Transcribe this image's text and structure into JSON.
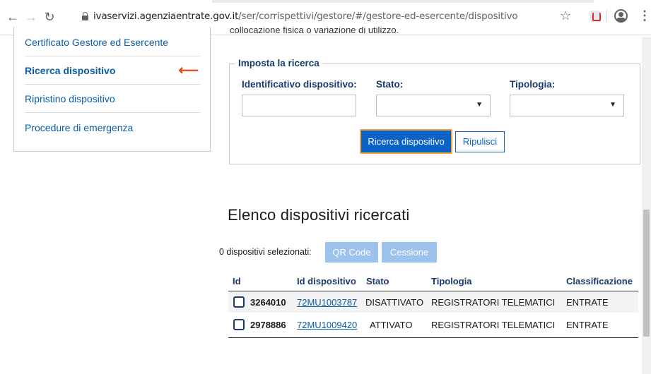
{
  "browser": {
    "url_domain": "ivaservizi.agenziaentrate.gov.it",
    "url_path": "/ser/corrispettivi/gestore/#/gestore-ed-esercente/dispositivo"
  },
  "sidebar": {
    "items": [
      {
        "label": "Certificato Gestore ed Esercente"
      },
      {
        "label": "Ricerca dispositivo"
      },
      {
        "label": "Ripristino dispositivo"
      },
      {
        "label": "Procedure di emergenza"
      }
    ],
    "active_marker": "⟵"
  },
  "top_text": "collocazione fisica o variazione di utilizzo.",
  "search": {
    "legend": "Imposta la ricerca",
    "id_label": "Identificativo dispositivo:",
    "id_value": "",
    "stato_label": "Stato:",
    "stato_value": "",
    "tipologia_label": "Tipologia:",
    "tipologia_value": "",
    "search_button": "Ricerca dispositivo",
    "reset_button": "Ripulisci"
  },
  "results": {
    "title": "Elenco dispositivi ricercati",
    "selected_count": "0 dispositivi selezionati:",
    "qr_button": "QR Code",
    "cession_button": "Cessione",
    "columns": [
      "Id",
      "Id dispositivo",
      "Stato",
      "Tipologia",
      "Classificazione"
    ],
    "rows": [
      {
        "id": "3264010",
        "device": "72MU1003787",
        "stato": "DISATTIVATO",
        "tipologia": "REGISTRATORI TELEMATICI",
        "classificazione": "ENTRATE"
      },
      {
        "id": "2978886",
        "device": "72MU1009420",
        "stato": "ATTIVATO",
        "tipologia": "REGISTRATORI TELEMATICI",
        "classificazione": "ENTRATE"
      }
    ]
  },
  "colors": {
    "primary": "#0b62c7",
    "focus_outline": "#f0a23c",
    "active_arrow": "#e74c1c",
    "disabled_button": "#9cc3ec",
    "heading_blue": "#1a3a6a"
  }
}
